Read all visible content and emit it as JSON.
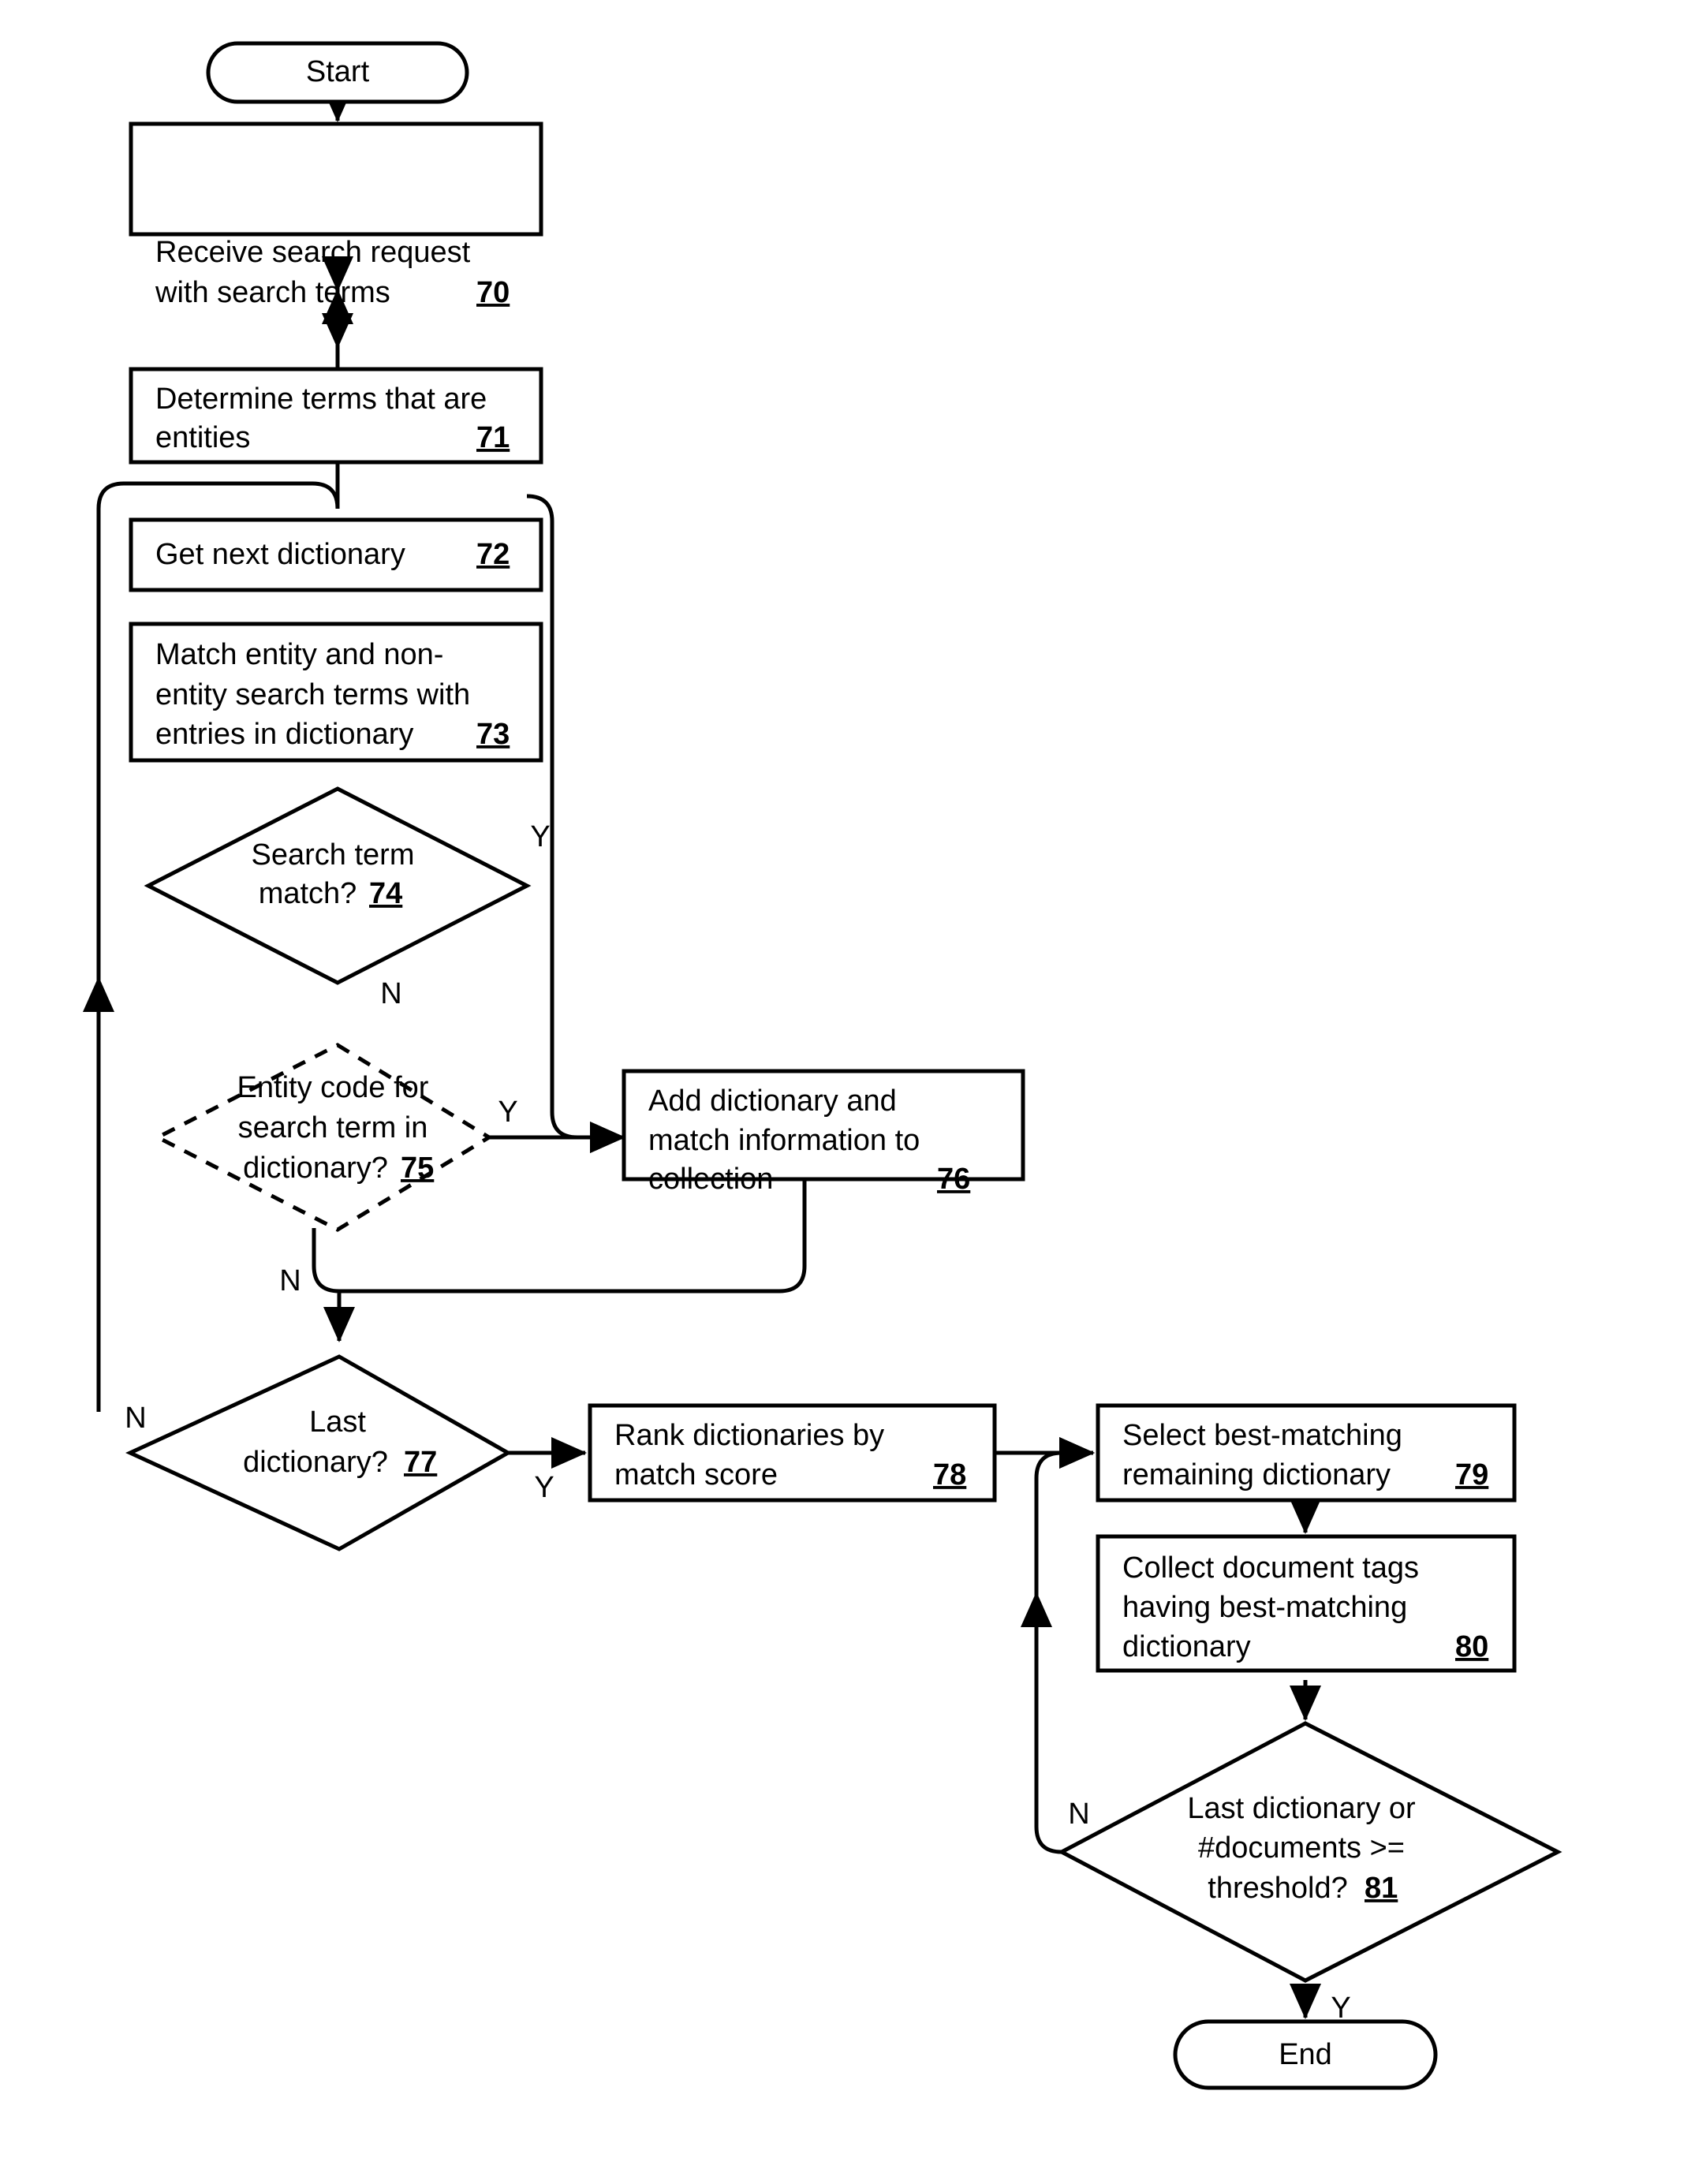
{
  "diagram": {
    "type": "flowchart",
    "title": "",
    "nodes": {
      "start": {
        "label": "Start",
        "shape": "terminator"
      },
      "n70": {
        "line1": "Receive search request",
        "line2": "with search terms",
        "ref": "70",
        "shape": "process"
      },
      "n71": {
        "line1": "Determine terms that are",
        "line2": "entities",
        "ref": "71",
        "shape": "process"
      },
      "n72": {
        "line1": "Get next dictionary",
        "ref": "72",
        "shape": "process"
      },
      "n73": {
        "line1": "Match entity and non-",
        "line2": "entity search terms with",
        "line3": "entries in dictionary",
        "ref": "73",
        "shape": "process"
      },
      "n74": {
        "line1": "Search term",
        "line2": "match?",
        "ref": "74",
        "shape": "decision"
      },
      "n75": {
        "line1": "Entity code for",
        "line2": "search term in",
        "line3": "dictionary?",
        "ref": "75",
        "shape": "decision-dashed"
      },
      "n76": {
        "line1": "Add dictionary and",
        "line2": "match information to",
        "line3": "collection",
        "ref": "76",
        "shape": "process"
      },
      "n77": {
        "line1": "Last",
        "line2": "dictionary?",
        "ref": "77",
        "shape": "decision"
      },
      "n78": {
        "line1": "Rank dictionaries by",
        "line2": "match score",
        "ref": "78",
        "shape": "process"
      },
      "n79": {
        "line1": "Select best-matching",
        "line2": "remaining dictionary",
        "ref": "79",
        "shape": "process"
      },
      "n80": {
        "line1": "Collect document tags",
        "line2": "having best-matching",
        "line3": "dictionary",
        "ref": "80",
        "shape": "process"
      },
      "n81": {
        "line1": "Last dictionary or",
        "line2": "#documents >=",
        "line3": "threshold?",
        "ref": "81",
        "shape": "decision"
      },
      "end": {
        "label": "End",
        "shape": "terminator"
      }
    },
    "branch_labels": {
      "n74_yes": "Y",
      "n74_no": "N",
      "n75_yes": "Y",
      "n75_no": "N",
      "n77_yes": "Y",
      "n77_no": "N",
      "n81_yes": "Y",
      "n81_no": "N"
    },
    "colors": {
      "stroke": "#000000",
      "fill": "#ffffff",
      "text": "#000000"
    }
  }
}
